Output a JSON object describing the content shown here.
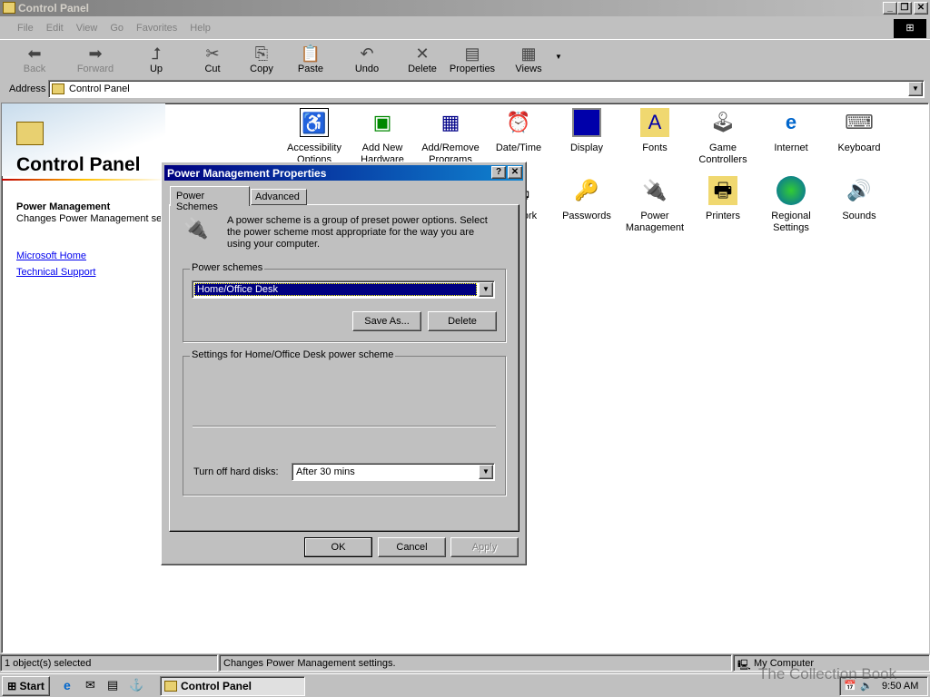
{
  "window": {
    "title": "Control Panel"
  },
  "menu": [
    "File",
    "Edit",
    "View",
    "Go",
    "Favorites",
    "Help"
  ],
  "toolbar": [
    {
      "label": "Back",
      "icon": "back-arrow-icon",
      "disabled": true
    },
    {
      "label": "Forward",
      "icon": "forward-arrow-icon",
      "disabled": true
    },
    {
      "label": "Up",
      "icon": "up-folder-icon"
    },
    {
      "label": "Cut",
      "icon": "scissors-icon"
    },
    {
      "label": "Copy",
      "icon": "copy-icon"
    },
    {
      "label": "Paste",
      "icon": "paste-icon"
    },
    {
      "label": "Undo",
      "icon": "undo-icon"
    },
    {
      "label": "Delete",
      "icon": "delete-x-icon"
    },
    {
      "label": "Properties",
      "icon": "properties-icon"
    },
    {
      "label": "Views",
      "icon": "views-icon"
    }
  ],
  "address": {
    "label": "Address",
    "value": "Control Panel"
  },
  "sidebar": {
    "title": "Control Panel",
    "item_title": "Power Management",
    "item_desc": "Changes Power Management settings.",
    "links": [
      "Microsoft Home",
      "Technical Support"
    ]
  },
  "icons": [
    {
      "label": "Accessibility Options"
    },
    {
      "label": "Add New Hardware"
    },
    {
      "label": "Add/Remove Programs"
    },
    {
      "label": "Date/Time"
    },
    {
      "label": "Display"
    },
    {
      "label": "Fonts"
    },
    {
      "label": "Game Controllers"
    },
    {
      "label": "Internet"
    },
    {
      "label": "Keyboard"
    },
    {
      "label": "Network"
    },
    {
      "label": "Passwords"
    },
    {
      "label": "Power Management"
    },
    {
      "label": "Printers"
    },
    {
      "label": "Regional Settings"
    },
    {
      "label": "Sounds"
    }
  ],
  "dialog": {
    "title": "Power Management Properties",
    "tabs": [
      "Power Schemes",
      "Advanced"
    ],
    "description": "A power scheme is a group of preset power options. Select the power scheme most appropriate for the way you are using your computer.",
    "schemes_label": "Power schemes",
    "scheme_value": "Home/Office Desk",
    "save_as": "Save As...",
    "delete": "Delete",
    "settings_label": "Settings for Home/Office Desk power scheme",
    "hdd_label": "Turn off hard disks:",
    "hdd_value": "After 30 mins",
    "ok": "OK",
    "cancel": "Cancel",
    "apply": "Apply"
  },
  "statusbar": {
    "selected": "1 object(s) selected",
    "desc": "Changes Power Management settings.",
    "zone": "My Computer"
  },
  "taskbar": {
    "start": "Start",
    "task": "Control Panel",
    "clock": "9:50 AM"
  },
  "watermark": "The Collection Book"
}
